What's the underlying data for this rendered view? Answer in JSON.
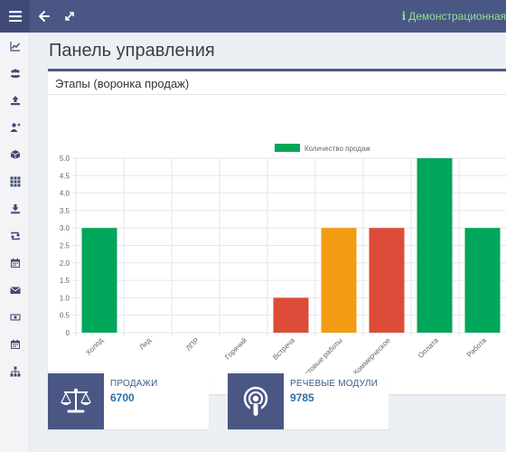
{
  "header": {
    "menu_icon": "bars-icon",
    "back_icon": "arrow-left-icon",
    "expand_icon": "expand-icon",
    "info_icon": "info-icon",
    "info_glyph": "i",
    "right_text": "Демонстрационная"
  },
  "sidebar": {
    "items": [
      {
        "icon": "line-chart-icon"
      },
      {
        "icon": "users-icon"
      },
      {
        "icon": "upload-icon"
      },
      {
        "icon": "user-plus-icon"
      },
      {
        "icon": "cube-icon"
      },
      {
        "icon": "grid-icon"
      },
      {
        "icon": "download-icon"
      },
      {
        "icon": "retweet-icon"
      },
      {
        "icon": "calendar-icon"
      },
      {
        "icon": "envelope-icon"
      },
      {
        "icon": "money-icon"
      },
      {
        "icon": "calendar-icon"
      },
      {
        "icon": "sitemap-icon"
      }
    ]
  },
  "page": {
    "title": "Панель управления"
  },
  "funnel_box": {
    "title": "Этапы (воронка продаж)"
  },
  "chart_data": {
    "type": "bar",
    "categories": [
      "Холод",
      "Лид",
      "ЛПР",
      "Горячий",
      "Встреча",
      "Тестовые работы",
      "Коммерческое",
      "Оплата",
      "Работа"
    ],
    "series": [
      {
        "name": "Количество продаж",
        "values": [
          3,
          0,
          0,
          0,
          1,
          3,
          3,
          5,
          3
        ]
      }
    ],
    "bar_colors": [
      "#00a65a",
      "#00a65a",
      "#00a65a",
      "#00a65a",
      "#dd4b39",
      "#f39c12",
      "#dd4b39",
      "#00a65a",
      "#00a65a"
    ],
    "legend_color": "#00a65a",
    "ylim": [
      0,
      5
    ],
    "yticks": [
      "0",
      "0.5",
      "1.0",
      "1.5",
      "2.0",
      "2.5",
      "3.0",
      "3.5",
      "4.0",
      "4.5",
      "5.0"
    ],
    "grid": true,
    "legend": "top-center",
    "title": "",
    "xlabel": "",
    "ylabel": ""
  },
  "stats": [
    {
      "label": "ПРОДАЖИ",
      "value": "6700",
      "icon": "balance-scale-icon"
    },
    {
      "label": "РЕЧЕВЫЕ МОДУЛИ",
      "value": "9785",
      "icon": "podcast-icon"
    }
  ],
  "colors": {
    "brand": "#4a5785",
    "green": "#00a65a",
    "red": "#dd4b39",
    "orange": "#f39c12",
    "info_text": "#8fe08f"
  }
}
